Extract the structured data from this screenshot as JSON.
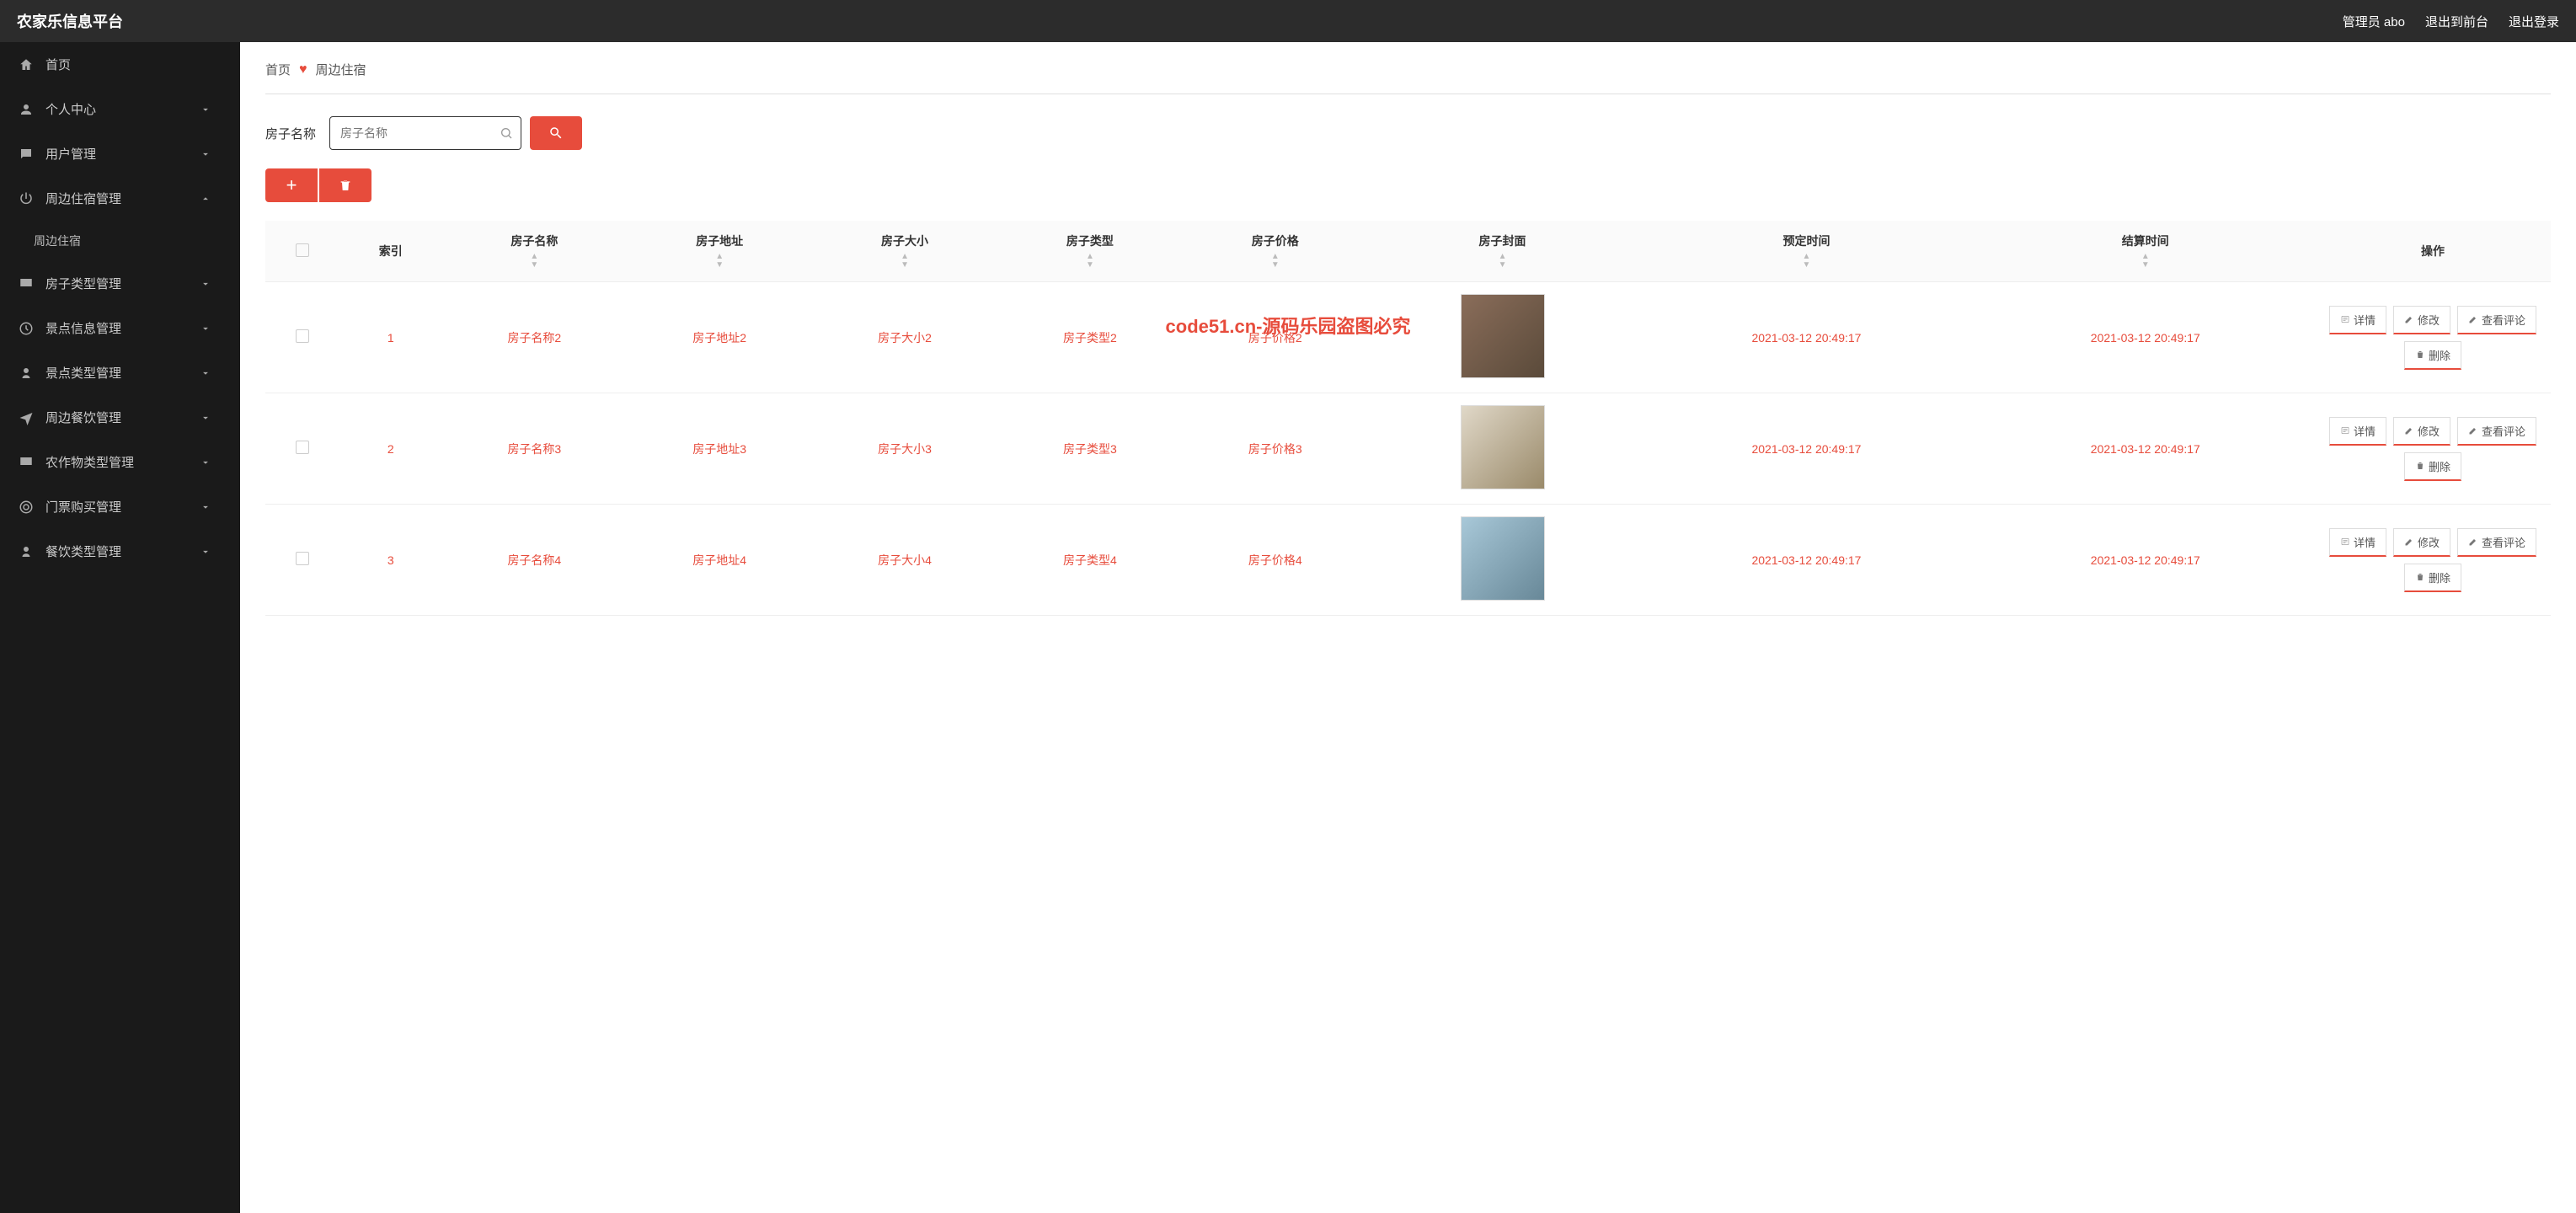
{
  "app_title": "农家乐信息平台",
  "topbar": {
    "admin_label": "管理员 abo",
    "exit_front": "退出到前台",
    "logout": "退出登录"
  },
  "sidebar": [
    {
      "icon": "home",
      "label": "首页",
      "expandable": false
    },
    {
      "icon": "user",
      "label": "个人中心",
      "expandable": true
    },
    {
      "icon": "msg",
      "label": "用户管理",
      "expandable": true
    },
    {
      "icon": "power",
      "label": "周边住宿管理",
      "expandable": true,
      "open": true,
      "children": [
        {
          "label": "周边住宿"
        }
      ]
    },
    {
      "icon": "monitor",
      "label": "房子类型管理",
      "expandable": true
    },
    {
      "icon": "clock",
      "label": "景点信息管理",
      "expandable": true
    },
    {
      "icon": "user2",
      "label": "景点类型管理",
      "expandable": true
    },
    {
      "icon": "send",
      "label": "周边餐饮管理",
      "expandable": true
    },
    {
      "icon": "monitor",
      "label": "农作物类型管理",
      "expandable": true
    },
    {
      "icon": "target",
      "label": "门票购买管理",
      "expandable": true
    },
    {
      "icon": "user2",
      "label": "餐饮类型管理",
      "expandable": true
    }
  ],
  "breadcrumb": {
    "home": "首页",
    "current": "周边住宿"
  },
  "search": {
    "label": "房子名称",
    "placeholder": "房子名称"
  },
  "table": {
    "headers": [
      "",
      "索引",
      "房子名称",
      "房子地址",
      "房子大小",
      "房子类型",
      "房子价格",
      "房子封面",
      "预定时间",
      "结算时间",
      "操作"
    ],
    "rows": [
      {
        "idx": "1",
        "name": "房子名称2",
        "addr": "房子地址2",
        "size": "房子大小2",
        "type": "房子类型2",
        "price": "房子价格2",
        "thumb": "t1",
        "book": "2021-03-12 20:49:17",
        "settle": "2021-03-12 20:49:17"
      },
      {
        "idx": "2",
        "name": "房子名称3",
        "addr": "房子地址3",
        "size": "房子大小3",
        "type": "房子类型3",
        "price": "房子价格3",
        "thumb": "t2",
        "book": "2021-03-12 20:49:17",
        "settle": "2021-03-12 20:49:17"
      },
      {
        "idx": "3",
        "name": "房子名称4",
        "addr": "房子地址4",
        "size": "房子大小4",
        "type": "房子类型4",
        "price": "房子价格4",
        "thumb": "t3",
        "book": "2021-03-12 20:49:17",
        "settle": "2021-03-12 20:49:17"
      }
    ],
    "ops": {
      "detail": "详情",
      "edit": "修改",
      "view_comments": "查看评论",
      "delete": "删除"
    }
  },
  "watermark": "code51.cn-源码乐园盗图必究",
  "wm_text": "code51.cn"
}
